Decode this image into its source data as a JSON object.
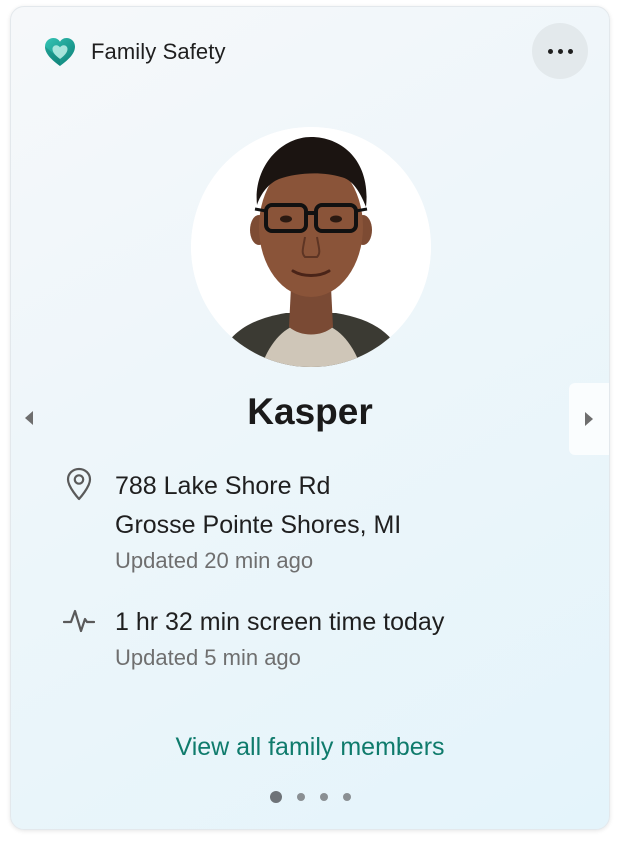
{
  "header": {
    "app_title": "Family Safety",
    "logo_icon": "family-safety-heart-logo",
    "more_icon": "more-horizontal-icon"
  },
  "member": {
    "name": "Kasper",
    "avatar_icon": "member-avatar-photo"
  },
  "location": {
    "icon": "location-pin-icon",
    "address_line1": "788 Lake Shore Rd",
    "address_line2": "Grosse Pointe Shores, MI",
    "updated": "Updated 20 min ago"
  },
  "screen_time": {
    "icon": "activity-pulse-icon",
    "summary": "1 hr 32 min screen time today",
    "updated": "Updated 5 min ago"
  },
  "footer": {
    "view_all_label": "View all family members"
  },
  "pager": {
    "pages": 4,
    "current_page": 1
  },
  "colors": {
    "accent": "#0f7b6c",
    "logo_teal": "#1aa39a",
    "card_bg_start": "#f6f8fa",
    "card_bg_end": "#e4f4fb"
  }
}
